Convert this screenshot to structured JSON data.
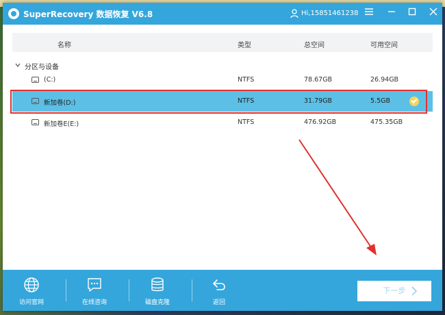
{
  "app": {
    "title": "SuperRecovery 数据恢复 V6.8",
    "user_label": "Hi,15851461238"
  },
  "table": {
    "headers": [
      "名称",
      "类型",
      "总空间",
      "可用空间"
    ],
    "group_label": "分区与设备",
    "rows": [
      {
        "name": "(C:)",
        "type": "NTFS",
        "total": "78.67GB",
        "free": "26.94GB",
        "selected": false
      },
      {
        "name": "新加卷(D:)",
        "type": "NTFS",
        "total": "31.79GB",
        "free": "5.5GB",
        "selected": true
      },
      {
        "name": "新加卷E(E:)",
        "type": "NTFS",
        "total": "476.92GB",
        "free": "475.35GB",
        "selected": false
      }
    ]
  },
  "footer": {
    "items": [
      {
        "label": "访问官网",
        "icon": "globe-icon"
      },
      {
        "label": "在线咨询",
        "icon": "chat-icon"
      },
      {
        "label": "磁盘克隆",
        "icon": "database-icon"
      },
      {
        "label": "返回",
        "icon": "back-icon"
      }
    ],
    "next_label": "下一步"
  },
  "colors": {
    "accent": "#34a6db",
    "selected_row": "#5cc0e6",
    "highlight": "#e0312f",
    "check": "#f4d65c"
  }
}
